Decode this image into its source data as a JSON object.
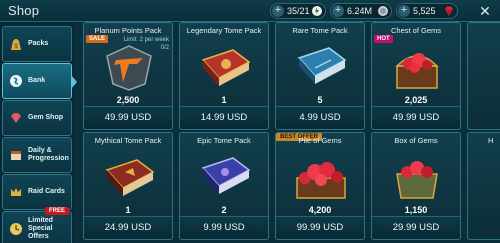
{
  "header": {
    "title": "Shop",
    "resources": [
      {
        "id": "energy",
        "value": "35/21",
        "icon": "energy-icon"
      },
      {
        "id": "silver",
        "value": "6.24M",
        "icon": "silver-icon"
      },
      {
        "id": "gems",
        "value": "5,525",
        "icon": "gem-icon"
      }
    ],
    "close_icon": "close-icon"
  },
  "sidebar": {
    "items": [
      {
        "label": "Packs",
        "icon": "bag-icon",
        "active": false
      },
      {
        "label": "Bank",
        "icon": "bank-icon",
        "active": true
      },
      {
        "label": "Gem Shop",
        "icon": "gem-shop-icon",
        "active": false
      },
      {
        "label": "Daily & Progression",
        "icon": "calendar-icon",
        "active": false
      },
      {
        "label": "Raid Cards",
        "icon": "crown-icon",
        "active": false
      },
      {
        "label": "Limited Special Offers",
        "icon": "clock-icon",
        "active": false,
        "badge": "FREE"
      }
    ]
  },
  "cards": [
    {
      "title": "Planum Points Pack",
      "count": "2,500",
      "price": "49.99 USD",
      "tag": "SALE",
      "limit": "Limit: 2 per week",
      "limit_count": "0/2",
      "art": "planum-points-icon"
    },
    {
      "title": "Legendary Tome Pack",
      "count": "1",
      "price": "14.99 USD",
      "art": "legendary-tome-icon"
    },
    {
      "title": "Rare Tome Pack",
      "count": "5",
      "price": "4.99 USD",
      "art": "rare-tome-icon"
    },
    {
      "title": "Chest of Gems",
      "count": "2,025",
      "price": "49.99 USD",
      "tag": "HOT",
      "art": "gem-chest-icon"
    },
    {
      "title": "Mythical Tome Pack",
      "count": "1",
      "price": "24.99 USD",
      "art": "mythical-tome-icon"
    },
    {
      "title": "Epic Tome Pack",
      "count": "2",
      "price": "9.99 USD",
      "art": "epic-tome-icon"
    },
    {
      "title": "Pile of Gems",
      "count": "4,200",
      "price": "99.99 USD",
      "tag": "BEST OFFER",
      "art": "gem-pile-icon"
    },
    {
      "title": "Box of Gems",
      "count": "1,150",
      "price": "29.99 USD",
      "art": "gem-box-icon"
    }
  ],
  "partial_titles": [
    "",
    "H"
  ],
  "colors": {
    "background": "#0a2f3a",
    "card_border": "#2b7387",
    "active_tab": "#5ec3dc",
    "gem_red": "#d62a3a",
    "gold": "#e3b23c"
  }
}
